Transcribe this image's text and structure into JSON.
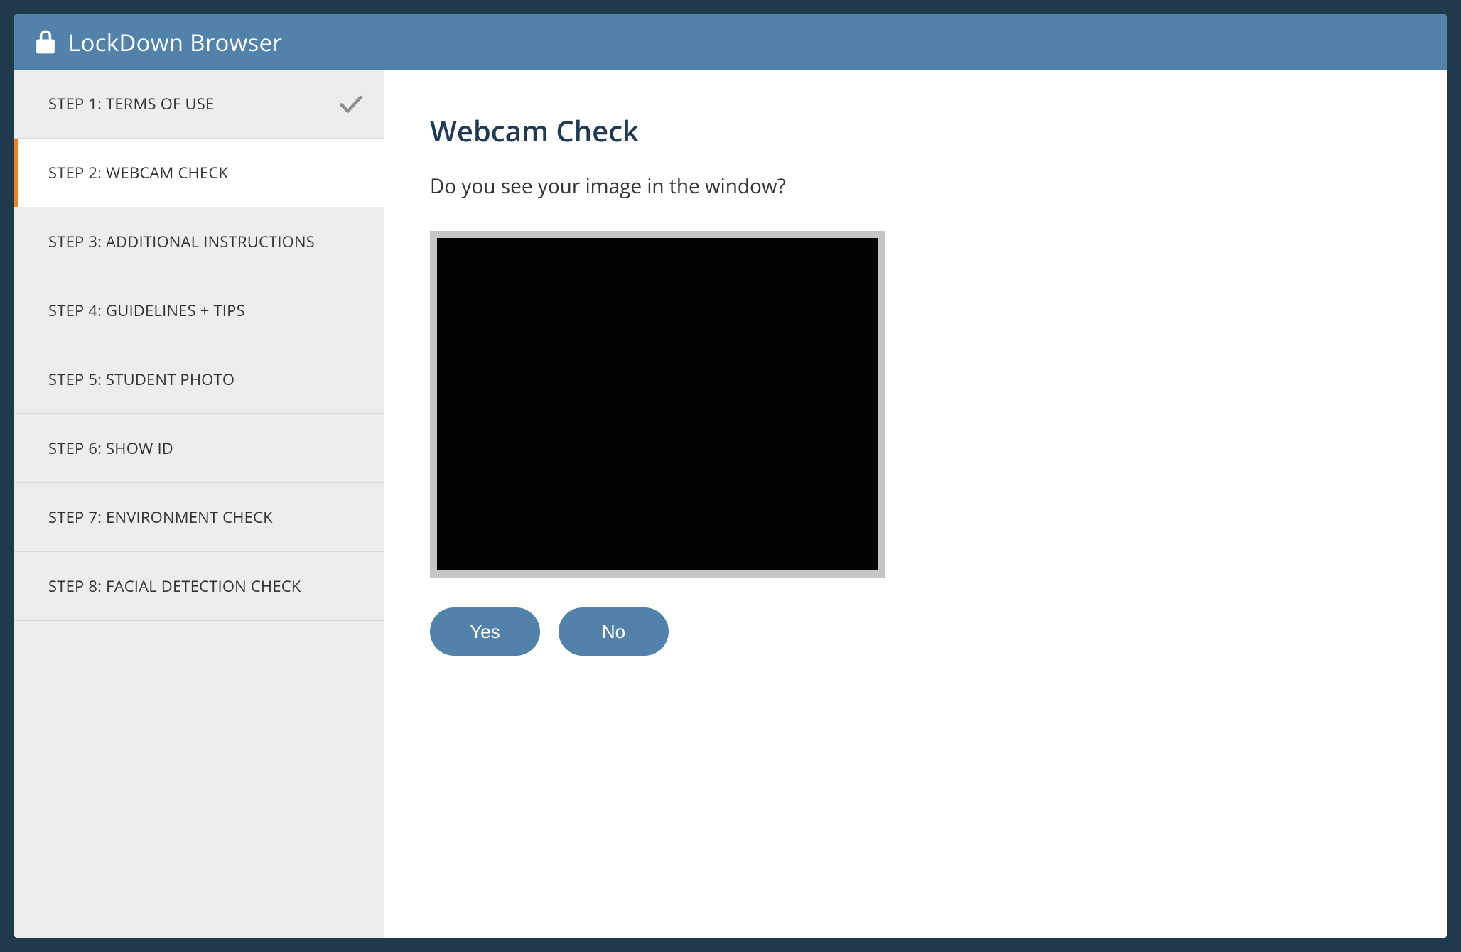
{
  "header": {
    "app_title": "LockDown Browser"
  },
  "sidebar": {
    "items": [
      {
        "label": "STEP 1: TERMS OF USE",
        "state": "completed"
      },
      {
        "label": "STEP 2: WEBCAM CHECK",
        "state": "active"
      },
      {
        "label": "STEP 3: ADDITIONAL INSTRUCTIONS",
        "state": "pending"
      },
      {
        "label": "STEP 4: GUIDELINES + TIPS",
        "state": "pending"
      },
      {
        "label": "STEP 5: STUDENT PHOTO",
        "state": "pending"
      },
      {
        "label": "STEP 6: SHOW ID",
        "state": "pending"
      },
      {
        "label": "STEP 7: ENVIRONMENT CHECK",
        "state": "pending"
      },
      {
        "label": "STEP 8: FACIAL DETECTION CHECK",
        "state": "pending"
      }
    ]
  },
  "main": {
    "title": "Webcam Check",
    "prompt": "Do you see your image in the window?",
    "buttons": {
      "yes": "Yes",
      "no": "No"
    }
  }
}
